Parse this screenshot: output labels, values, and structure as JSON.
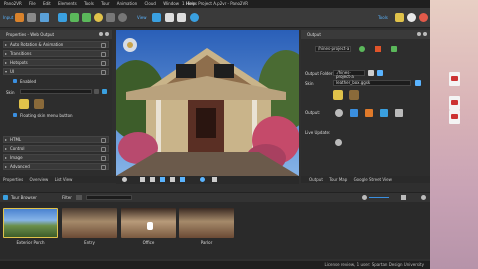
{
  "app": {
    "title": "1 Hines Project A.p2vr - Pano2VR",
    "menus": [
      "Pano2VR",
      "File",
      "Edit",
      "Elements",
      "Tools",
      "Tour",
      "Animation",
      "Cloud",
      "Window",
      "Help"
    ]
  },
  "toolbar": {
    "input_label": "Input",
    "view_label": "View",
    "tools_label": "Tools"
  },
  "properties": {
    "header": "Properties - Web Output",
    "sections": [
      "Auto Rotation & Animation",
      "Transitions",
      "Hotspots",
      "UI",
      "HTML",
      "Control",
      "Image",
      "Advanced"
    ],
    "ui": {
      "enabled_label": "Enabled",
      "skin_label": "Skin",
      "floating_label": "Floating skin menu button"
    }
  },
  "output": {
    "header": "Output",
    "preset_value": "/hines-project-a",
    "output_folder_label": "Output Folder:",
    "output_folder_value": "./hines-project-a",
    "skin_label": "Skin",
    "skin_value": "leather_box.ggsk",
    "output_label": "Output:",
    "live_update_label": "Live Update:"
  },
  "bottom_tabs_left": [
    "Properties",
    "Overview",
    "List View"
  ],
  "bottom_tabs_right": [
    "Output",
    "Tour Map",
    "Google Street View"
  ],
  "tour_browser": {
    "label": "Tour Browser",
    "filter_label": "Filter",
    "thumbnails": [
      {
        "label": "Exterior Porch"
      },
      {
        "label": "Entry"
      },
      {
        "label": "Office"
      },
      {
        "label": "Parlor"
      }
    ]
  },
  "status": {
    "text": "License review, 1 user: Spartan Design University"
  },
  "desktop": {
    "files": [
      "",
      "",
      ""
    ]
  }
}
